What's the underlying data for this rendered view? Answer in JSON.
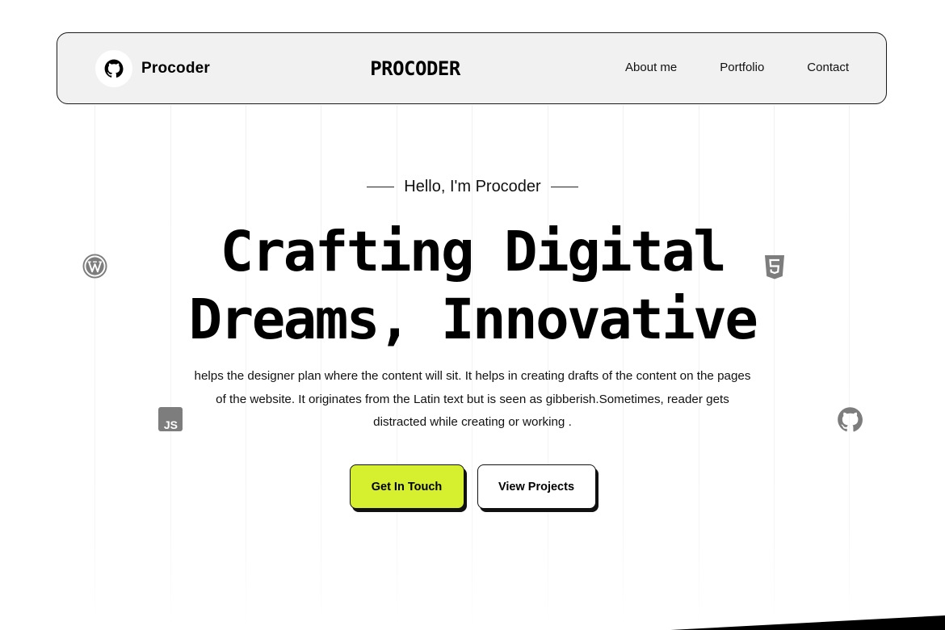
{
  "header": {
    "brand_name": "Procoder",
    "brand_icon": "github-icon",
    "center_logo": "PROCODER",
    "nav": [
      {
        "label": "About me"
      },
      {
        "label": "Portfolio"
      },
      {
        "label": "Contact"
      }
    ]
  },
  "hero": {
    "eyebrow": "Hello, I'm Procoder",
    "headline_line1": "Crafting Digital",
    "headline_line2": "Dreams, Innovative",
    "description": "helps the designer plan where the content will sit. It helps in creating drafts of the content on the pages of the website. It originates from the Latin text but is seen as gibberish.Sometimes, reader gets distracted while creating or working .",
    "primary_button": "Get In Touch",
    "secondary_button": "View Projects"
  },
  "floating_icons": [
    "wordpress-icon",
    "html5-icon",
    "javascript-icon",
    "github-icon"
  ],
  "colors": {
    "accent": "#d6f030",
    "header_bg": "#f1f1f1",
    "text": "#000000",
    "icon_gray": "#7d7d7d"
  }
}
